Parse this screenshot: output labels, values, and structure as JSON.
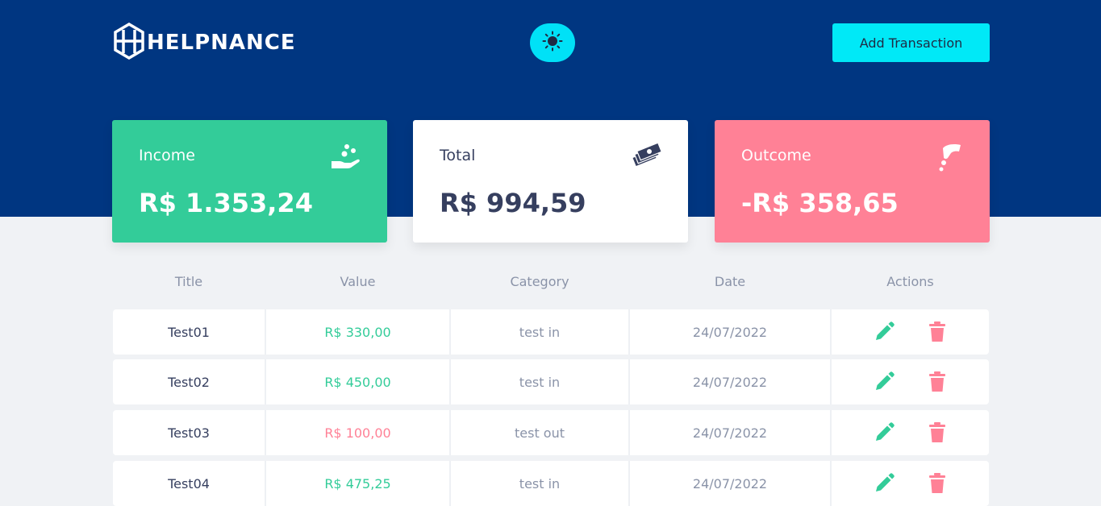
{
  "header": {
    "logo_text": "HELPNANCE",
    "add_button_label": "Add Transaction"
  },
  "summary": {
    "income": {
      "label": "Income",
      "value": "R$ 1.353,24",
      "icon": "money-hand-icon",
      "color": "#33CC99"
    },
    "total": {
      "label": "Total",
      "value": "R$ 994,59",
      "icon": "money-stack-icon",
      "color": "#FFFFFF"
    },
    "outcome": {
      "label": "Outcome",
      "value": "-R$ 358,65",
      "icon": "money-out-icon",
      "color": "#FF8196"
    }
  },
  "table": {
    "headers": [
      "Title",
      "Value",
      "Category",
      "Date",
      "Actions"
    ],
    "rows": [
      {
        "title": "Test01",
        "value": "R$ 330,00",
        "type": "income",
        "category": "test in",
        "date": "24/07/2022"
      },
      {
        "title": "Test02",
        "value": "R$ 450,00",
        "type": "income",
        "category": "test in",
        "date": "24/07/2022"
      },
      {
        "title": "Test03",
        "value": "R$ 100,00",
        "type": "outcome",
        "category": "test out",
        "date": "24/07/2022"
      },
      {
        "title": "Test04",
        "value": "R$ 475,25",
        "type": "income",
        "category": "test in",
        "date": "24/07/2022"
      }
    ]
  },
  "colors": {
    "header_bg": "#003681",
    "accent": "#00E1F7",
    "income": "#33CC99",
    "outcome": "#FF8196",
    "text_dark": "#363F5F",
    "text_muted": "#8A93A8"
  }
}
